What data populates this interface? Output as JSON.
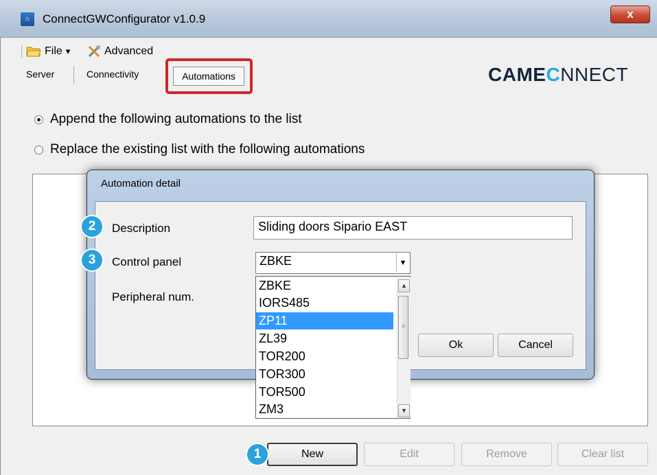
{
  "window": {
    "title": "ConnectGWConfigurator v1.0.9",
    "close_label": "x"
  },
  "menu": {
    "file": "File",
    "file_arrow": "▾",
    "advanced": "Advanced"
  },
  "tabs": {
    "server": "Server",
    "connectivity": "Connectivity",
    "automations": "Automations"
  },
  "logo": {
    "part1": "CAME",
    "part2": "C",
    "part3": "NNECT"
  },
  "radios": {
    "append": {
      "label": "Append the following automations to the list",
      "checked": true
    },
    "replace": {
      "label": "Replace the existing list with the following automations",
      "checked": false
    }
  },
  "buttons": {
    "new": "New",
    "edit": "Edit",
    "remove": "Remove",
    "clear": "Clear list"
  },
  "badges": {
    "one": "1",
    "two": "2",
    "three": "3"
  },
  "dialog": {
    "title": "Automation detail",
    "description_label": "Description",
    "description_value": "Sliding doors Sipario EAST",
    "control_panel_label": "Control panel",
    "control_panel_value": "ZBKE",
    "peripheral_label": "Peripheral num.",
    "ok": "Ok",
    "cancel": "Cancel",
    "options": [
      "ZBKE",
      "IORS485",
      "ZP11",
      "ZL39",
      "TOR200",
      "TOR300",
      "TOR500",
      "ZM3"
    ],
    "highlighted_option": "ZP11"
  },
  "colors": {
    "highlight_border": "#d0262d",
    "badge": "#2aa2dc",
    "selection": "#3399ff"
  }
}
